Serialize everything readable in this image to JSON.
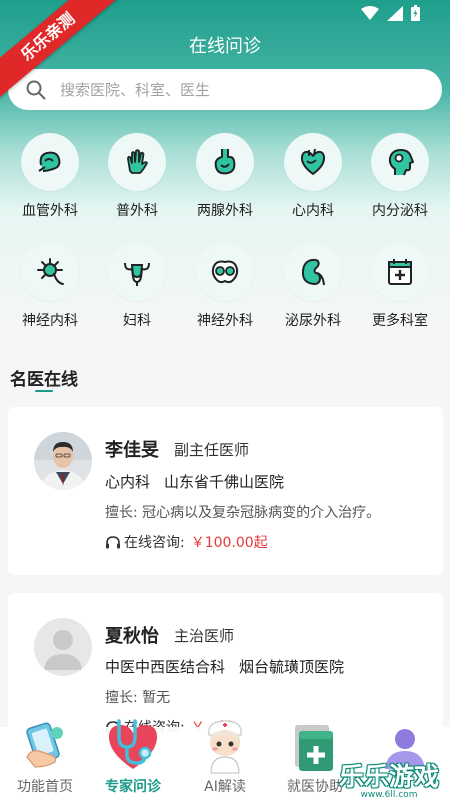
{
  "status_bar": {
    "icons": [
      "wifi-icon",
      "signal-icon",
      "battery-icon"
    ]
  },
  "corner_badge": "乐乐亲测",
  "header": {
    "title": "在线问诊"
  },
  "search": {
    "placeholder": "搜索医院、科室、医生"
  },
  "departments": [
    {
      "label": "血管外科",
      "icon": "blood-vessel-icon"
    },
    {
      "label": "普外科",
      "icon": "hand-icon"
    },
    {
      "label": "两腺外科",
      "icon": "stomach-icon"
    },
    {
      "label": "心内科",
      "icon": "heart-icon"
    },
    {
      "label": "内分泌科",
      "icon": "head-profile-icon"
    },
    {
      "label": "神经内科",
      "icon": "neuron-icon"
    },
    {
      "label": "妇科",
      "icon": "uterus-icon"
    },
    {
      "label": "神经外科",
      "icon": "brain-icon"
    },
    {
      "label": "泌尿外科",
      "icon": "kidney-icon"
    },
    {
      "label": "更多科室",
      "icon": "calendar-plus-icon"
    }
  ],
  "section": {
    "title": "名医在线"
  },
  "doctors": [
    {
      "name": "李佳旻",
      "title": "副主任医师",
      "department": "心内科",
      "hospital": "山东省千佛山医院",
      "skill": "擅长: 冠心病以及复杂冠脉病变的介入治疗。",
      "consult_label": "在线咨询:",
      "price": "￥100.00起"
    },
    {
      "name": "夏秋怡",
      "title": "主治医师",
      "department": "中医中西医结合科",
      "hospital": "烟台毓璜顶医院",
      "skill": "擅长: 暂无",
      "consult_label": "在线咨询:",
      "price": "￥...起"
    }
  ],
  "tabbar": {
    "tabs": [
      {
        "label": "功能首页",
        "active": false
      },
      {
        "label": "专家问诊",
        "active": true
      },
      {
        "label": "AI解读",
        "active": false
      },
      {
        "label": "就医协助",
        "active": false
      },
      {
        "label": "",
        "active": false
      }
    ]
  },
  "watermark": {
    "text": "乐乐游戏",
    "sub": "www.6ll.com"
  },
  "colors": {
    "primary": "#1a9a88",
    "price": "#e33b3b",
    "badge": "#e02828"
  }
}
